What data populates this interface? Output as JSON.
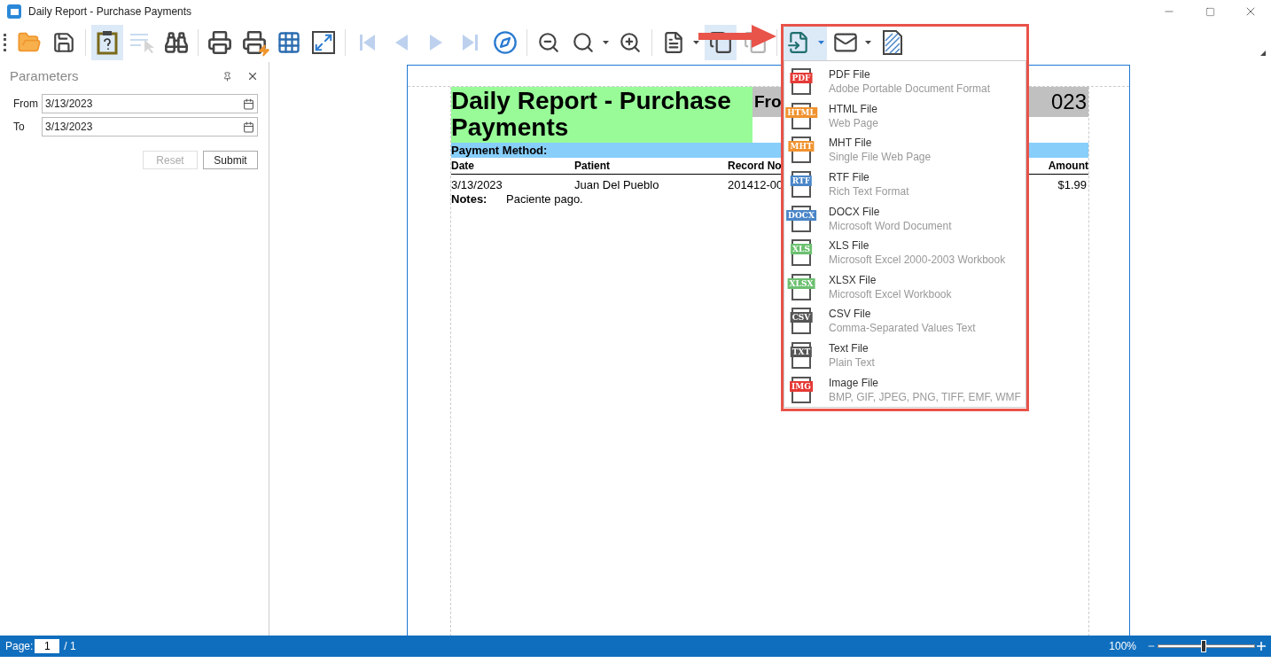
{
  "window": {
    "title": "Daily Report - Purchase Payments"
  },
  "toolbar": [
    {
      "selected": false,
      "disabled": false,
      "dropdown": false
    },
    {
      "selected": false,
      "disabled": false,
      "dropdown": false
    },
    {
      "selected": true,
      "disabled": false,
      "dropdown": false
    },
    {
      "selected": false,
      "disabled": true,
      "dropdown": false
    },
    {
      "selected": false,
      "disabled": false,
      "dropdown": false
    },
    {
      "selected": false,
      "disabled": false,
      "dropdown": false
    },
    {
      "selected": false,
      "disabled": false,
      "dropdown": false
    },
    {
      "selected": false,
      "disabled": false,
      "dropdown": false
    },
    {
      "selected": false,
      "disabled": false,
      "dropdown": false
    },
    {
      "selected": false,
      "disabled": true,
      "dropdown": false
    },
    {
      "selected": false,
      "disabled": true,
      "dropdown": false
    },
    {
      "selected": false,
      "disabled": true,
      "dropdown": false
    },
    {
      "selected": false,
      "disabled": true,
      "dropdown": false
    },
    {
      "selected": false,
      "disabled": false,
      "dropdown": false
    },
    {
      "selected": false,
      "disabled": false,
      "dropdown": false
    },
    {
      "selected": false,
      "disabled": false,
      "dropdown": true
    },
    {
      "selected": false,
      "disabled": false,
      "dropdown": false
    },
    {
      "selected": false,
      "disabled": false,
      "dropdown": true
    },
    {
      "selected": true,
      "disabled": false,
      "dropdown": false
    },
    {
      "selected": false,
      "disabled": true,
      "dropdown": false
    },
    {
      "selected": true,
      "disabled": false,
      "dropdown": true
    },
    {
      "selected": false,
      "disabled": false,
      "dropdown": true
    },
    {
      "selected": false,
      "disabled": false,
      "dropdown": false
    }
  ],
  "parameters": {
    "title": "Parameters",
    "fields": [
      {
        "label": "From",
        "value": "3/13/2023"
      },
      {
        "label": "To",
        "value": "3/13/2023"
      }
    ],
    "buttons": [
      {
        "label": "Reset",
        "disabled": true
      },
      {
        "label": "Submit",
        "disabled": false
      }
    ]
  },
  "report": {
    "title": "Daily Report - Purchase Payments",
    "range_start": "Fro",
    "range_end": "023",
    "group": "Payment Method:",
    "columns": [
      "Date",
      "Patient",
      "Record No",
      "Amount"
    ],
    "row": {
      "date": "3/13/2023",
      "patient": "Juan Del Pueblo",
      "record": "201412-00",
      "amount": "$1.99"
    },
    "notes_label": "Notes:",
    "notes": "Paciente pago."
  },
  "export_menu": [
    {
      "badge": "PDF",
      "color": "#e53935",
      "label": "PDF File",
      "description": "Adobe Portable Document Format"
    },
    {
      "badge": "HTML",
      "color": "#f0922e",
      "label": "HTML File",
      "description": "Web Page"
    },
    {
      "badge": "MHT",
      "color": "#f0922e",
      "label": "MHT File",
      "description": "Single File Web Page"
    },
    {
      "badge": "RTF",
      "color": "#4a86c8",
      "label": "RTF File",
      "description": "Rich Text Format"
    },
    {
      "badge": "DOCX",
      "color": "#4a86c8",
      "label": "DOCX File",
      "description": "Microsoft Word Document"
    },
    {
      "badge": "XLS",
      "color": "#6cc070",
      "label": "XLS File",
      "description": "Microsoft Excel 2000-2003 Workbook"
    },
    {
      "badge": "XLSX",
      "color": "#6cc070",
      "label": "XLSX File",
      "description": "Microsoft Excel Workbook"
    },
    {
      "badge": "CSV",
      "color": "#555555",
      "label": "CSV File",
      "description": "Comma-Separated Values Text"
    },
    {
      "badge": "TXT",
      "color": "#555555",
      "label": "Text File",
      "description": "Plain Text"
    },
    {
      "badge": "IMG",
      "color": "#e53935",
      "label": "Image File",
      "description": "BMP, GIF, JPEG, PNG, TIFF, EMF, WMF"
    }
  ],
  "status_bar": {
    "page_label": "Page:",
    "page": "1",
    "page_total": "/ 1",
    "zoom": "100%",
    "zoom_slider": {
      "level": 0.47
    }
  }
}
